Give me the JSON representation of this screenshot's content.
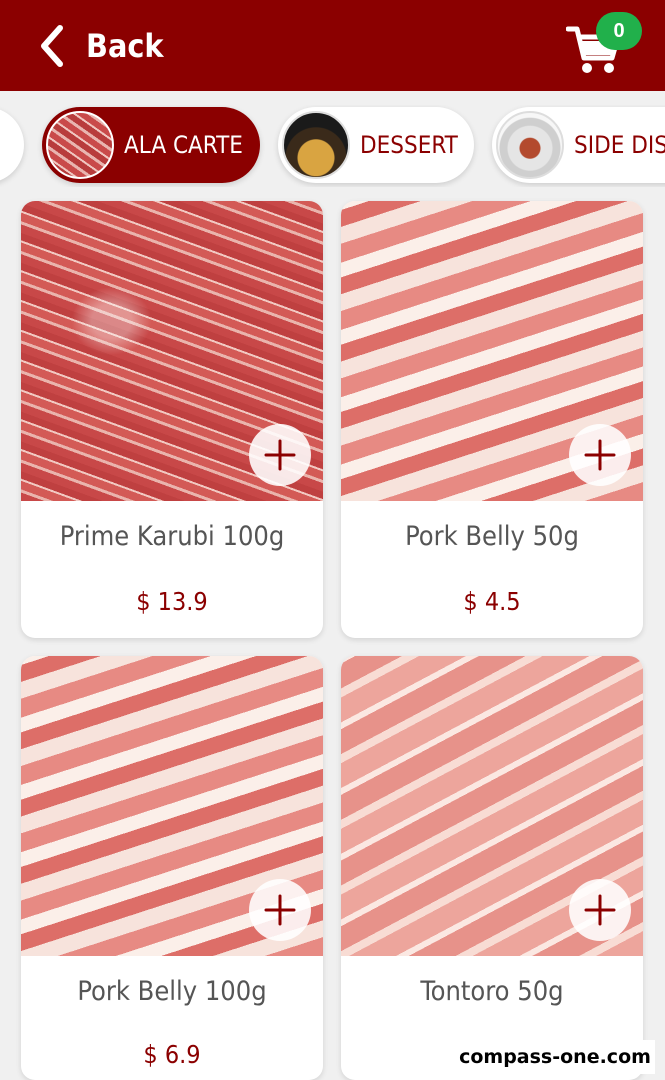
{
  "header": {
    "back_label": "Back",
    "cart_count": "0",
    "background": "#8b0000",
    "badge_color": "#21b04b"
  },
  "categories": [
    {
      "label": "",
      "icon": "partial-chip",
      "active": false
    },
    {
      "label": "ALA CARTE",
      "icon": "meat-thumbnail",
      "active": true
    },
    {
      "label": "DESSERT",
      "icon": "dessert-thumbnail",
      "active": false
    },
    {
      "label": "SIDE DISH",
      "icon": "side-dish-thumbnail",
      "active": false
    }
  ],
  "products": [
    {
      "name": "Prime Karubi 100g",
      "price": "$ 13.9",
      "image": "marbled-beef-slices"
    },
    {
      "name": "Pork Belly 50g",
      "price": "$ 4.5",
      "image": "pork-belly-slices"
    },
    {
      "name": "Pork Belly 100g",
      "price": "$ 6.9",
      "image": "pork-belly-slices"
    },
    {
      "name": "Tontoro 50g",
      "price": "",
      "image": "tontoro-slices"
    }
  ],
  "watermark": "compass-one.com",
  "colors": {
    "accent": "#8b0000",
    "text": "#555555",
    "background": "#f0f0f0"
  }
}
